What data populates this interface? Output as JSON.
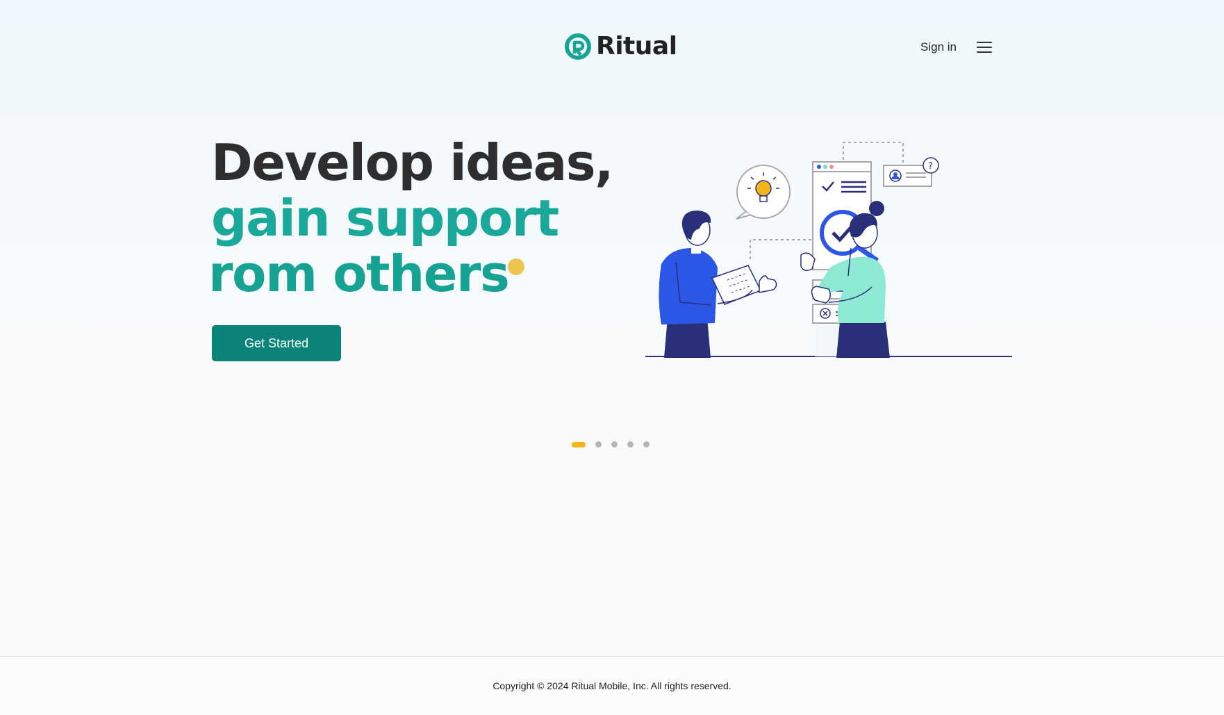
{
  "header": {
    "brand": "Ritual",
    "signin_label": "Sign in",
    "menu_icon": "hamburger-menu-icon"
  },
  "hero": {
    "line1": "Develop ideas,",
    "line2": "gain support",
    "line3": "rom others",
    "cta_label": "Get Started",
    "illustration": "collaboration-illustration"
  },
  "carousel": {
    "slides": 5,
    "active_index": 0
  },
  "footer": {
    "copyright": "Copyright © 2024 Ritual Mobile, Inc. All rights reserved."
  },
  "colors": {
    "brand_teal": "#1aa89a",
    "button_teal": "#0a8478",
    "accent_yellow": "#f4b51b",
    "headline_dark": "#2e2e2e"
  }
}
